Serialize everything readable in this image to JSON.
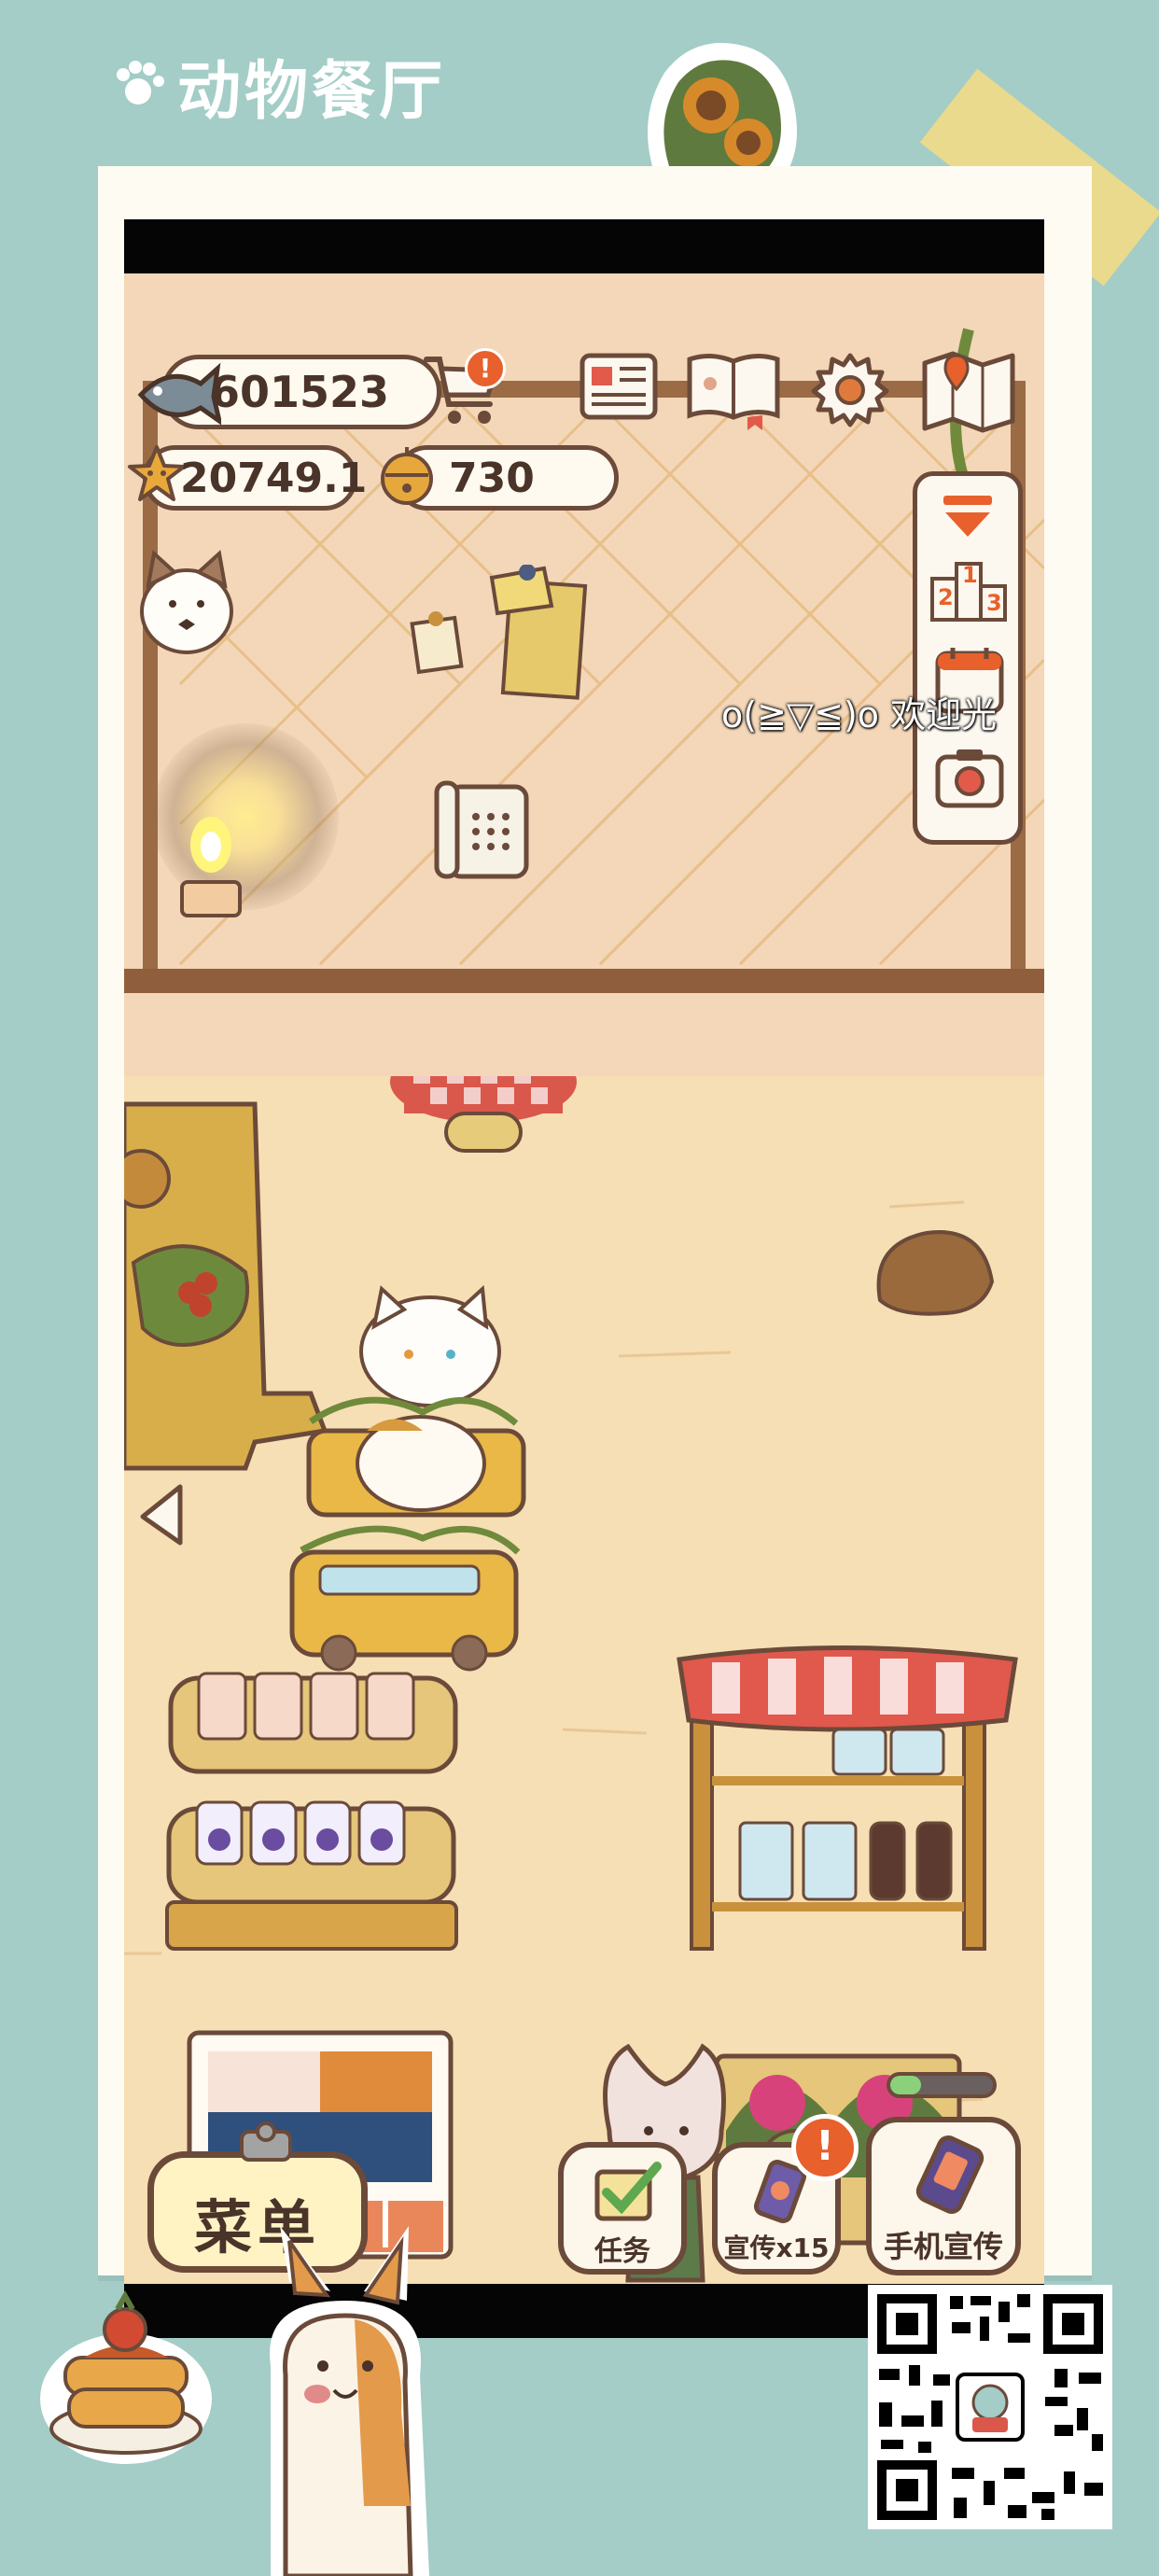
{
  "app_title": "动物餐厅",
  "currency": {
    "fish": "601523",
    "stars": "20749.1",
    "bells": "730"
  },
  "cart_badge": "!",
  "promo_badge": "!",
  "welcome_text": "o(≧▽≦)o 欢迎光",
  "side_panel": {
    "ranking_numbers": [
      "1",
      "2",
      "3"
    ]
  },
  "bottom_bar": {
    "menu_label": "菜单",
    "task_label": "任务",
    "promote_label": "宣传x15",
    "phone_promote_label": "手机宣传"
  },
  "colors": {
    "background": "#a3cdc6",
    "outline": "#6b4a3a",
    "wall": "#f3d7b8",
    "floor": "#f6dfb4",
    "badge": "#e8602c",
    "progress_fill": "#8bd17c"
  },
  "promo_progress": 0.3
}
